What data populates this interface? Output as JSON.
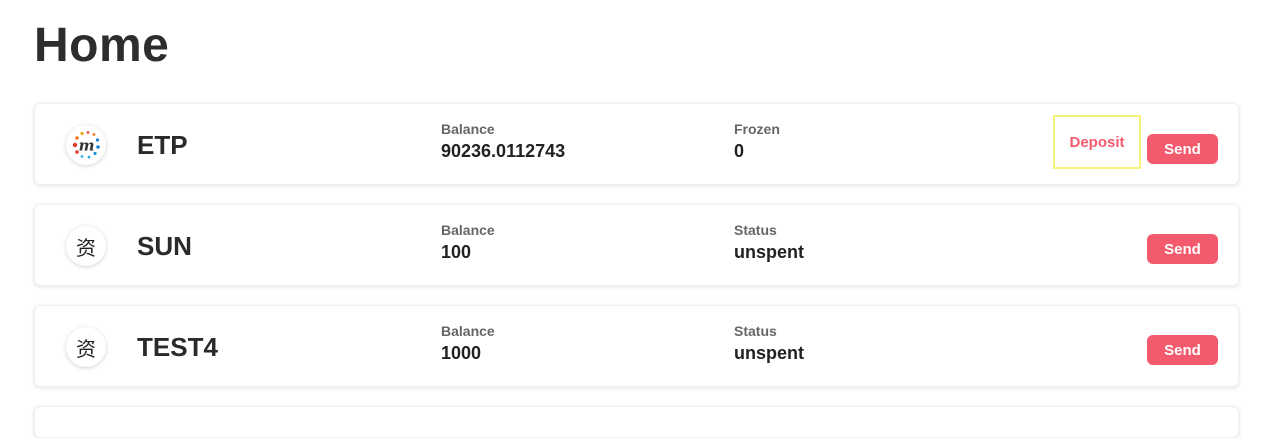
{
  "page": {
    "title": "Home"
  },
  "assets": [
    {
      "symbol": "ETP",
      "icon": "metaverse-logo-icon",
      "icon_glyph": "m",
      "col1_label": "Balance",
      "col1_value": "90236.0112743",
      "col2_label": "Frozen",
      "col2_value": "0",
      "deposit_label": "Deposit",
      "send_label": "Send"
    },
    {
      "symbol": "SUN",
      "icon": "asset-glyph-icon",
      "icon_glyph": "资",
      "col1_label": "Balance",
      "col1_value": "100",
      "col2_label": "Status",
      "col2_value": "unspent",
      "send_label": "Send"
    },
    {
      "symbol": "TEST4",
      "icon": "asset-glyph-icon",
      "icon_glyph": "资",
      "col1_label": "Balance",
      "col1_value": "1000",
      "col2_label": "Status",
      "col2_value": "unspent",
      "send_label": "Send"
    }
  ],
  "colors": {
    "accent": "#f45a6d",
    "highlight_border": "#f7f27a",
    "title": "#2d2d2d"
  }
}
